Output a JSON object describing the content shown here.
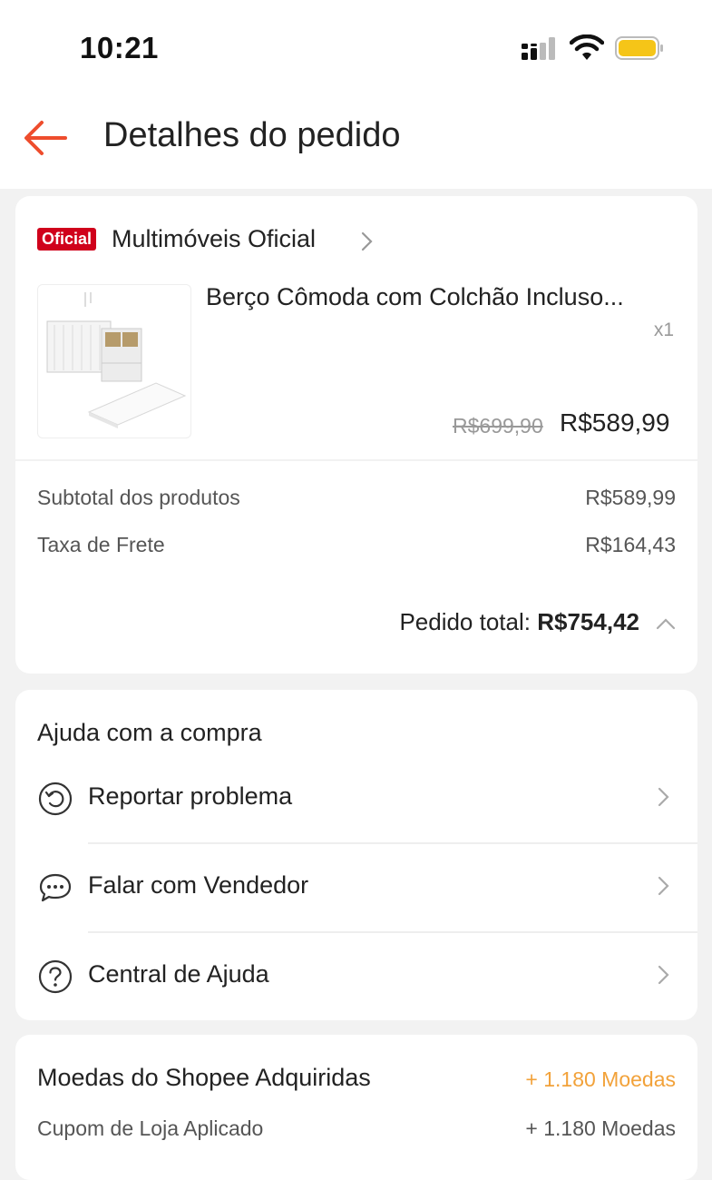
{
  "status_bar": {
    "time": "10:21",
    "battery_color": "#f5c518"
  },
  "header": {
    "title": "Detalhes do pedido",
    "accent_color": "#ee4d2d"
  },
  "shop": {
    "badge": "Oficial",
    "name": "Multimóveis Oficial"
  },
  "product": {
    "name": "Berço Cômoda com Colchão Incluso...",
    "quantity": "x1",
    "old_price": "R$699,90",
    "price": "R$589,99"
  },
  "summary": {
    "subtotal_label": "Subtotal dos produtos",
    "subtotal_value": "R$589,99",
    "shipping_label": "Taxa de Frete",
    "shipping_value": "R$164,43",
    "total_label": "Pedido total:",
    "total_value": "R$754,42"
  },
  "help": {
    "title": "Ajuda com a compra",
    "items": [
      {
        "label": "Reportar problema",
        "icon": "report-problem-icon"
      },
      {
        "label": "Falar com Vendedor",
        "icon": "chat-icon"
      },
      {
        "label": "Central de Ajuda",
        "icon": "help-question-icon"
      }
    ]
  },
  "coins": {
    "title": "Moedas do Shopee Adquiridas",
    "value": "+ 1.180 Moedas",
    "value_color": "#f2a23a",
    "coupon_label": "Cupom de Loja Aplicado",
    "coupon_value": "+ 1.180 Moedas"
  }
}
